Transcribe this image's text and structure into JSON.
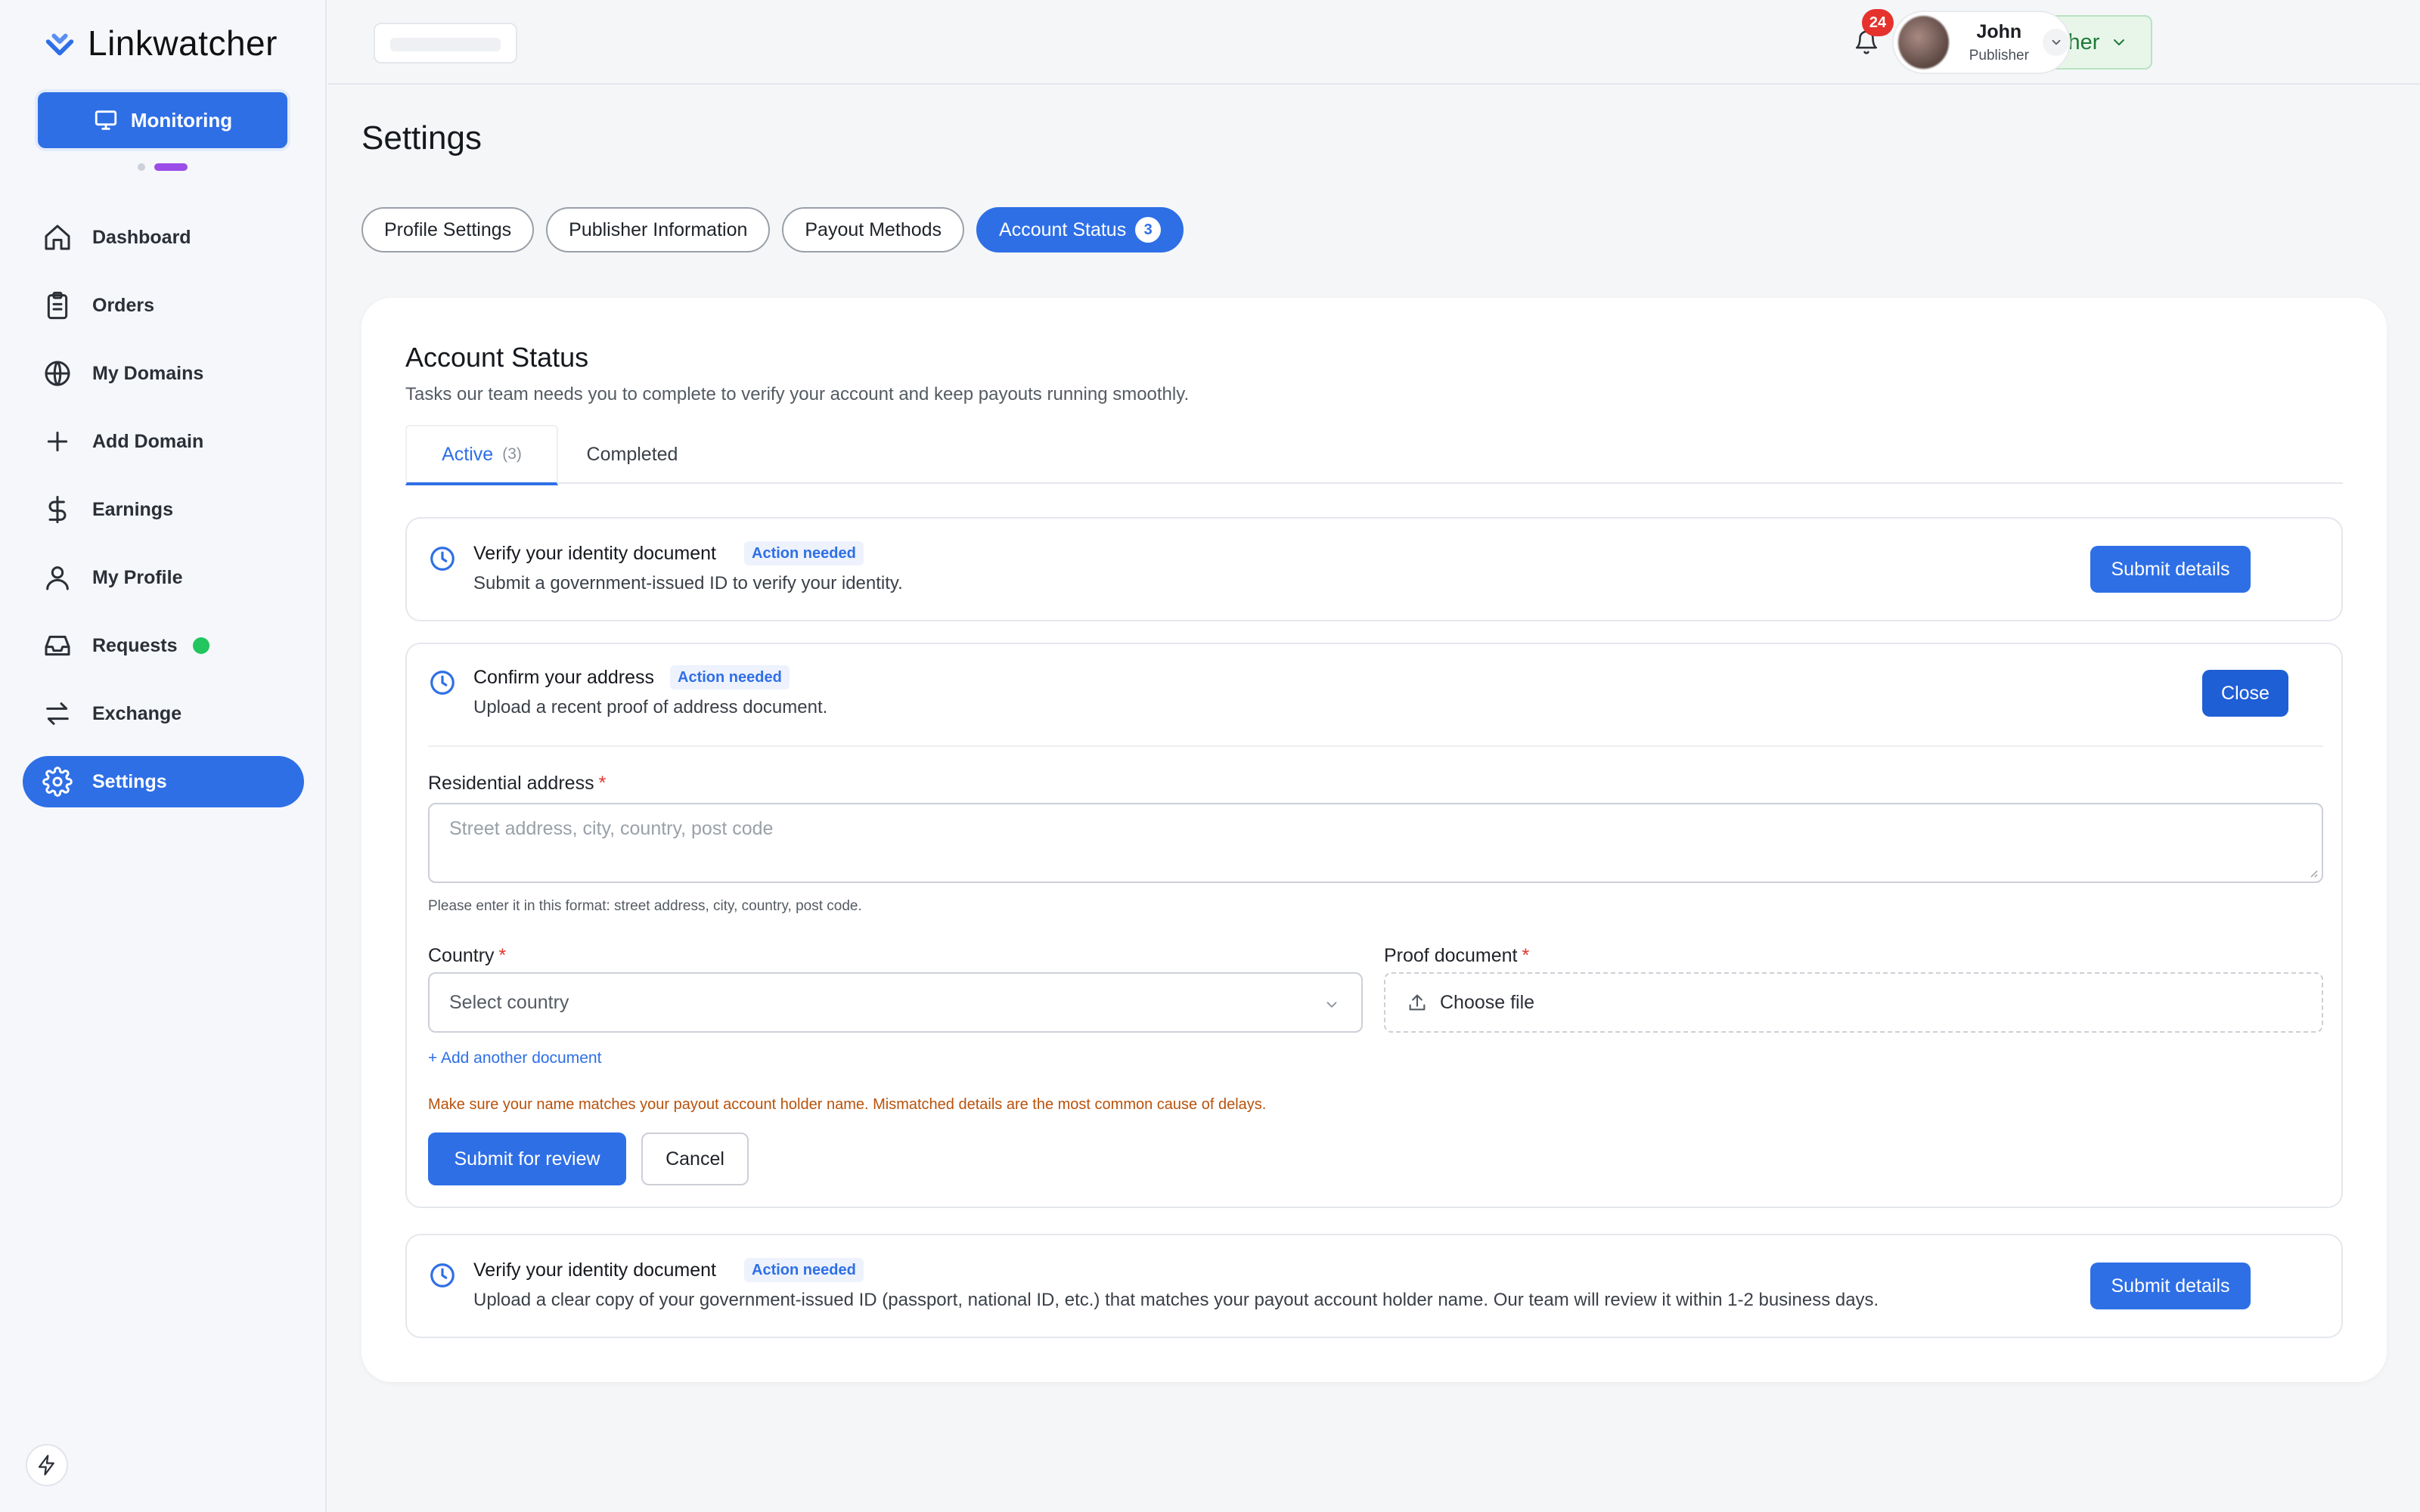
{
  "app": {
    "name": "Linkwatcher",
    "mode_button": "Monitoring"
  },
  "sidebar": {
    "items": [
      {
        "label": "Dashboard",
        "icon": "home-icon"
      },
      {
        "label": "Orders",
        "icon": "clipboard-icon"
      },
      {
        "label": "My Domains",
        "icon": "globe-icon"
      },
      {
        "label": "Add Domain",
        "icon": "plus-icon"
      },
      {
        "label": "Earnings",
        "icon": "dollar-icon"
      },
      {
        "label": "My Profile",
        "icon": "user-icon"
      },
      {
        "label": "Requests",
        "icon": "inbox-icon"
      },
      {
        "label": "Exchange",
        "icon": "exchange-icon"
      },
      {
        "label": "Settings",
        "icon": "gear-icon",
        "active": true
      }
    ]
  },
  "topbar": {
    "role_switch": "Publisher",
    "notification_count": "24",
    "user_name": "John",
    "user_role": "Publisher"
  },
  "page": {
    "title": "Settings",
    "tabs": [
      {
        "label": "Profile Settings"
      },
      {
        "label": "Publisher Information"
      },
      {
        "label": "Payout Methods"
      },
      {
        "label": "Account Status",
        "count": "3",
        "active": true
      }
    ]
  },
  "account_status": {
    "title": "Account Status",
    "subtitle": "Tasks our team needs you to complete to verify your account and keep payouts running smoothly.",
    "subtabs": {
      "active_label": "Active",
      "active_count": "(3)",
      "completed_label": "Completed"
    },
    "tasks": [
      {
        "title": "Verify your identity document",
        "badge": "Action needed",
        "description": "Submit a government-issued ID to verify your identity.",
        "action": "Submit details"
      },
      {
        "title": "Confirm your address",
        "badge": "Action needed",
        "description": "Upload a recent proof of address document.",
        "action": "Close",
        "form": {
          "address_label": "Residential address",
          "address_placeholder": "Street address, city, country, post code",
          "address_hint": "Please enter it in this format: street address, city, country, post code.",
          "country_label": "Country",
          "country_placeholder": "Select country",
          "proof_label": "Proof document",
          "proof_button": "Choose file",
          "add_document": "+ Add another document",
          "warning": "Make sure your name matches your payout account holder name. Mismatched details are the most common cause of delays.",
          "submit": "Submit for review",
          "cancel": "Cancel"
        }
      },
      {
        "title": "Verify your identity document",
        "badge": "Action needed",
        "description": "Upload a clear copy of your government-issued ID (passport, national ID, etc.) that matches your payout account holder name. Our team will review it within 1-2 business days.",
        "action": "Submit details"
      }
    ]
  },
  "colors": {
    "accent": "#2e6fe6",
    "success": "#22c55e",
    "danger": "#e5322d",
    "warning_text": "#b8520b"
  }
}
